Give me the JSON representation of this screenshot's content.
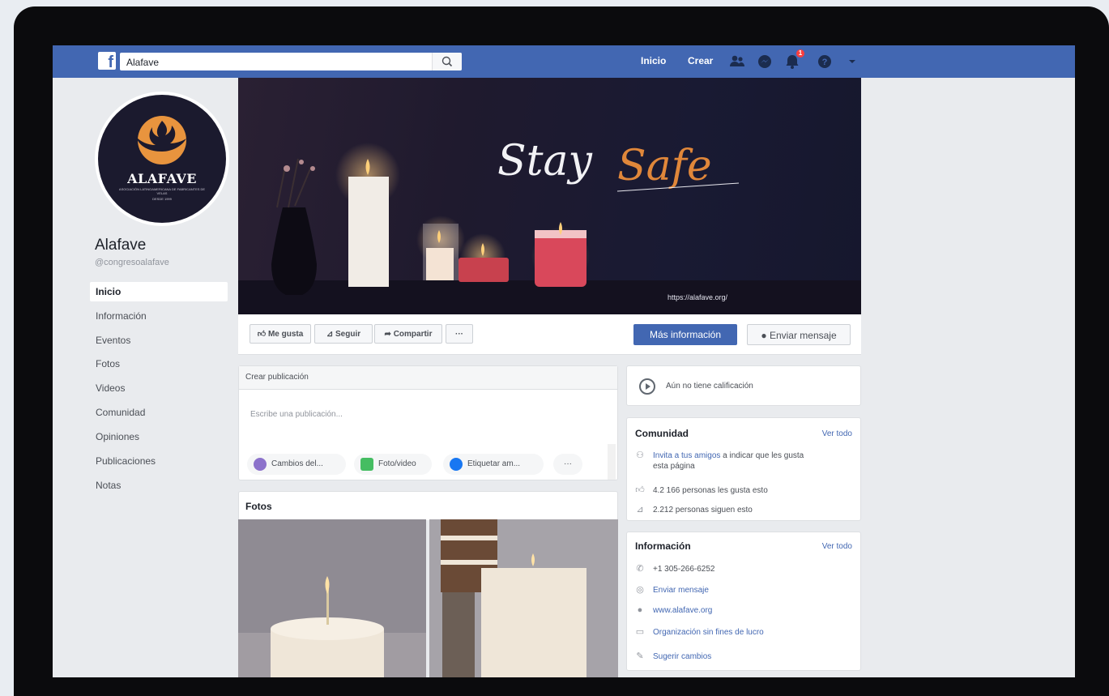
{
  "topbar": {
    "logo": "f",
    "search_value": "Alafave",
    "search_icon": "search-icon",
    "nav_home": "Inicio",
    "nav_create": "Crear",
    "notification_count": "1"
  },
  "profile": {
    "logo_name": "ALAFAVE",
    "logo_sub": "ASOCIACIÓN LATINOAMERICANA DE FABRICANTES DE VELAS",
    "logo_year": "DESDE 1999",
    "name": "Alafave",
    "handle": "@congresoalafave"
  },
  "sidebar": {
    "items": [
      {
        "label": "Inicio"
      },
      {
        "label": "Información"
      },
      {
        "label": "Eventos"
      },
      {
        "label": "Fotos"
      },
      {
        "label": "Videos"
      },
      {
        "label": "Comunidad"
      },
      {
        "label": "Opiniones"
      },
      {
        "label": "Publicaciones"
      },
      {
        "label": "Notas"
      }
    ]
  },
  "cover": {
    "title_word1": "Stay",
    "title_word2": "Safe",
    "url": "https://alafave.org/"
  },
  "actions": {
    "like": "Me gusta",
    "follow": "Seguir",
    "share": "Compartir",
    "more": "···",
    "more_info": "Más información",
    "send_message": "Enviar mensaje"
  },
  "composer": {
    "header": "Crear publicación",
    "placeholder": "Escribe una publicación...",
    "chip1": "Cambios del...",
    "chip2": "Foto/video",
    "chip3": "Etiquetar am...",
    "chip_more": "···"
  },
  "photos": {
    "title": "Fotos"
  },
  "rating": {
    "text": "Aún no tiene calificación"
  },
  "community": {
    "title": "Comunidad",
    "see_all": "Ver todo",
    "invite_link": "Invita a tus amigos",
    "invite_rest": " a indicar que les gusta",
    "invite_rest2": "esta página",
    "likes": "4.2 166 personas les gusta esto",
    "followers": "2.212 personas siguen esto"
  },
  "info": {
    "title": "Información",
    "see_all": "Ver todo",
    "phone": "+1 305-266-6252",
    "message": "Enviar mensaje",
    "website": "www.alafave.org",
    "category": "Organización sin fines de lucro",
    "suggest": "Sugerir cambios"
  },
  "colors": {
    "brand": "#4267b2",
    "accent_orange": "#e0873a"
  }
}
